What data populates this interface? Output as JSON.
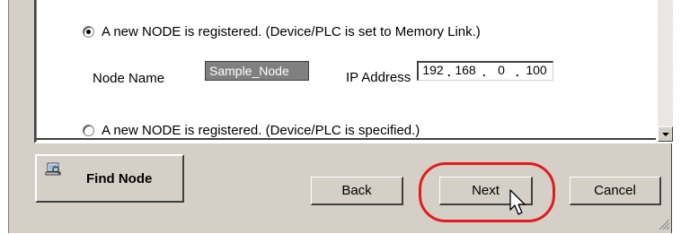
{
  "options": {
    "memory_link": {
      "label": "A new NODE is registered. (Device/PLC is set to Memory Link.)",
      "selected": true
    },
    "node_name": {
      "label": "Node Name",
      "value": "Sample_Node"
    },
    "ip_address": {
      "label": "IP Address",
      "octets": [
        "192",
        "168",
        "0",
        "100"
      ]
    },
    "device_specified": {
      "label": "A new NODE is registered. (Device/PLC is specified.)",
      "selected": false
    }
  },
  "buttons": {
    "find_node": "Find Node",
    "back": "Back",
    "next": "Next",
    "cancel": "Cancel"
  },
  "icons": {
    "find_node": "magnifier-computer-icon",
    "scroll_down": "chevron-down-icon",
    "cursor": "mouse-pointer-icon",
    "resize": "resize-grip-icon"
  },
  "colors": {
    "highlight": "#e41b1b",
    "dialog_face": "#d4d0c8",
    "selected_field": "#808080"
  }
}
